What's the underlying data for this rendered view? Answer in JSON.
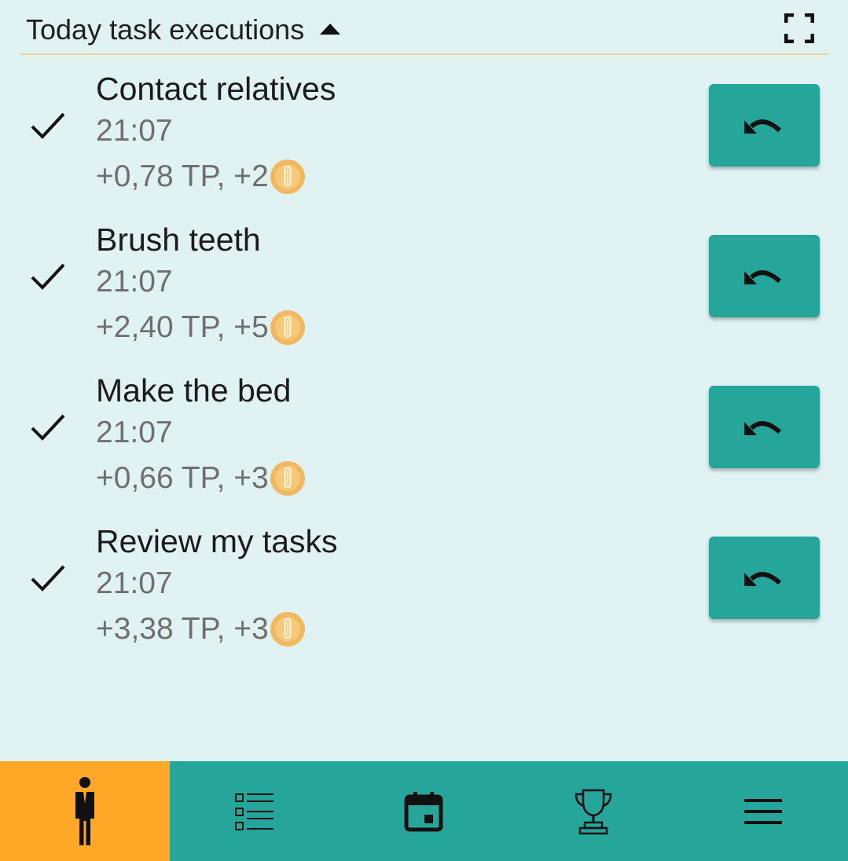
{
  "header": {
    "title": "Today task executions",
    "collapse_icon": "caret-up-icon",
    "expand_icon": "fullscreen-icon"
  },
  "tasks": [
    {
      "title": "Contact relatives",
      "time": "21:07",
      "reward": "+0,78 TP, +2",
      "done": true
    },
    {
      "title": "Brush teeth",
      "time": "21:07",
      "reward": "+2,40 TP, +5",
      "done": true
    },
    {
      "title": "Make the bed",
      "time": "21:07",
      "reward": "+0,66 TP, +3",
      "done": true
    },
    {
      "title": "Review my tasks",
      "time": "21:07",
      "reward": "+3,38 TP, +3",
      "done": true
    }
  ],
  "nav": {
    "items": [
      {
        "icon": "person-icon",
        "active": true
      },
      {
        "icon": "checklist-icon",
        "active": false
      },
      {
        "icon": "calendar-icon",
        "active": false
      },
      {
        "icon": "trophy-icon",
        "active": false
      },
      {
        "icon": "menu-icon",
        "active": false
      }
    ]
  },
  "colors": {
    "background": "#e0f2f1",
    "accent": "#26a69a",
    "active_tab": "#ffa726",
    "divider": "#e8d69a",
    "coin": "#f0b860"
  }
}
